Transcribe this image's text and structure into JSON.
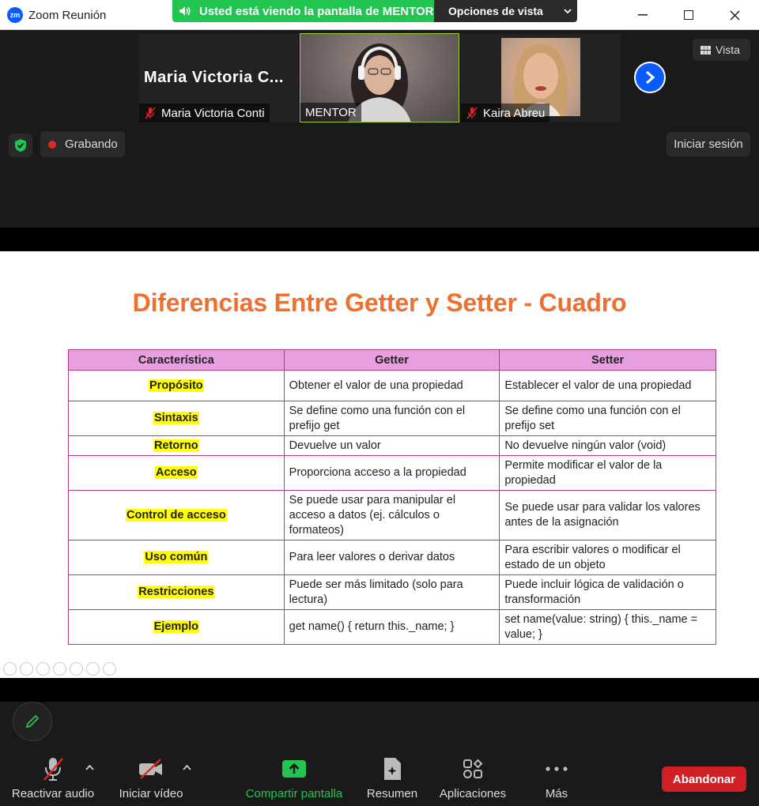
{
  "window": {
    "title": "Zoom Reunión",
    "logo_text": "zm"
  },
  "share_banner": {
    "text": "Usted está viendo la pantalla de MENTOR",
    "view_options": "Opciones de vista"
  },
  "gallery": {
    "tiles": [
      {
        "display_name": "Maria Victoria C...",
        "label": "Maria Victoria Conti",
        "muted": true
      },
      {
        "label": "MENTOR",
        "muted": false,
        "active_speaker": true
      },
      {
        "label": "Kaira Abreu",
        "muted": true
      }
    ],
    "vista_label": "Vista"
  },
  "status": {
    "recording_label": "Grabando",
    "login_label": "Iniciar sesión"
  },
  "slide": {
    "title": "Diferencias Entre Getter y Setter - Cuadro",
    "columns": [
      "Característica",
      "Getter",
      "Setter"
    ],
    "rows": [
      {
        "feature": "Propósito",
        "getter": "Obtener el valor de una propiedad",
        "setter": "Establecer el valor de una propiedad"
      },
      {
        "feature": "Sintaxis",
        "getter": "Se define como una función con el prefijo get",
        "setter": "Se define como una función con el prefijo set"
      },
      {
        "feature": "Retorno",
        "getter": "Devuelve un valor",
        "setter": "No devuelve ningún valor (void)"
      },
      {
        "feature": "Acceso",
        "getter": "Proporciona acceso a la propiedad",
        "setter": "Permite modificar el valor de la propiedad"
      },
      {
        "feature": "Control de acceso",
        "getter": "Se puede usar para manipular el acceso a datos (ej. cálculos o formateos)",
        "setter": "Se puede usar para validar los valores antes de la asignación"
      },
      {
        "feature": "Uso común",
        "getter": "Para leer valores o derivar datos",
        "setter": "Para escribir valores o modificar el estado de un objeto"
      },
      {
        "feature": "Restricciones",
        "getter": "Puede ser más limitado (solo para lectura)",
        "setter": "Puede incluir lógica de validación o transformación"
      },
      {
        "feature": "Ejemplo",
        "getter": "get name() { return this._name; }",
        "setter": "set name(value: string) { this._name = value; }"
      }
    ]
  },
  "toolbar": {
    "audio": "Reactivar audio",
    "video": "Iniciar vídeo",
    "share": "Compartir pantalla",
    "summary": "Resumen",
    "apps": "Aplicaciones",
    "more": "Más",
    "leave": "Abandonar"
  },
  "colors": {
    "accent_green": "#23c552",
    "zoom_blue": "#0b5cff",
    "title_orange": "#ed7031",
    "header_pink": "#e79fe0",
    "highlight_yellow": "#ffff00",
    "leave_red": "#d01f25"
  }
}
